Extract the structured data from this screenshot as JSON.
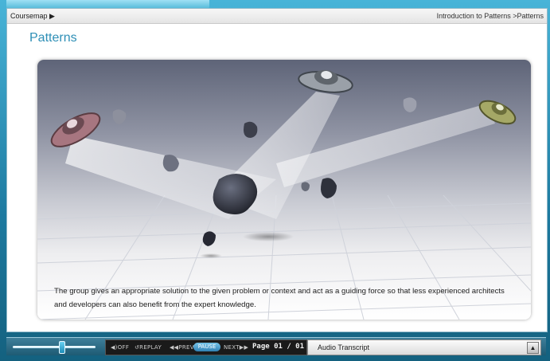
{
  "topbar": {
    "coursemap_label": "Coursemap ▶",
    "breadcrumb": "Introduction to Patterns  >Patterns"
  },
  "page": {
    "title": "Patterns",
    "caption_line1": "The group gives an appropriate solution to the given problem or context and act as a guiding force so that less experienced architects",
    "caption_line2": "and developers can also benefit from the expert knowledge."
  },
  "controls": {
    "audio_off": "◀)OFF",
    "replay": "↺REPLAY",
    "prev": "◀◀PREV",
    "pause": "PAUSE",
    "next": "NEXT▶▶",
    "page_indicator": "Page 01 / 01",
    "volume_level": 0.6
  },
  "transcript": {
    "label": "Audio Transcript",
    "toggle_icon": "▲"
  },
  "icons": {
    "ufo_left": "ufo-icon",
    "ufo_center": "ufo-icon",
    "ufo_right": "ufo-icon"
  },
  "colors": {
    "accent": "#2e8fb6",
    "frame": "#1f7fa3"
  }
}
